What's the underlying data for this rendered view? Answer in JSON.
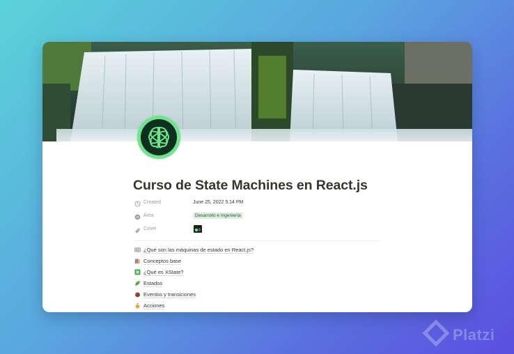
{
  "page": {
    "title": "Curso de State Machines en React.js",
    "properties": [
      {
        "icon": "clock-icon",
        "name": "Created",
        "value": "June 25, 2022 5:14 PM"
      },
      {
        "icon": "list-icon",
        "name": "Área",
        "tag": "Desarrollo e Ingeniería",
        "tag_color": "#dbeddb"
      },
      {
        "icon": "attachment-icon",
        "name": "Cover"
      }
    ],
    "links": [
      {
        "icon": "keyboard-icon",
        "label": "¿Qué son las máquinas de estado en React.js?"
      },
      {
        "icon": "books-icon",
        "label": "Conceptos base"
      },
      {
        "icon": "cross-mark-icon",
        "label": "¿Qué es XState?"
      },
      {
        "icon": "leaf-icon",
        "label": "Estados"
      },
      {
        "icon": "chestnut-icon",
        "label": "Eventos y transiciones"
      },
      {
        "icon": "pointing-down-icon",
        "label": "Acciones"
      }
    ]
  },
  "watermark": {
    "text": "Platzi"
  },
  "colors": {
    "page_icon_bg": "#6ee58b",
    "text": "#37352f",
    "muted": "#9b9a97"
  }
}
